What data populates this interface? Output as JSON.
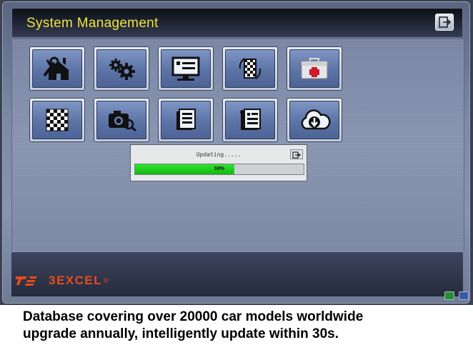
{
  "window": {
    "title": "System Management"
  },
  "tiles": [
    {
      "icon": "home-tools-icon"
    },
    {
      "icon": "gears-icon"
    },
    {
      "icon": "monitor-settings-icon"
    },
    {
      "icon": "checkerboard-sync-icon"
    },
    {
      "icon": "first-aid-kit-icon"
    },
    {
      "icon": "checkerboard-icon"
    },
    {
      "icon": "camera-search-icon"
    },
    {
      "icon": "document-stack-icon"
    },
    {
      "icon": "document-edit-icon"
    },
    {
      "icon": "cloud-download-icon"
    }
  ],
  "update_dialog": {
    "title": "Updating.....",
    "progress": 0.59,
    "progress_label": "59%",
    "progress_color": "#1fd01f"
  },
  "branding": {
    "logo_text": "3EXCEL",
    "registered_mark": "®",
    "logo_color": "#e84a1c"
  },
  "caption": {
    "line1": "Database covering over 20000 car models worldwide",
    "line2": "upgrade annually, intelligently update within 30s."
  }
}
